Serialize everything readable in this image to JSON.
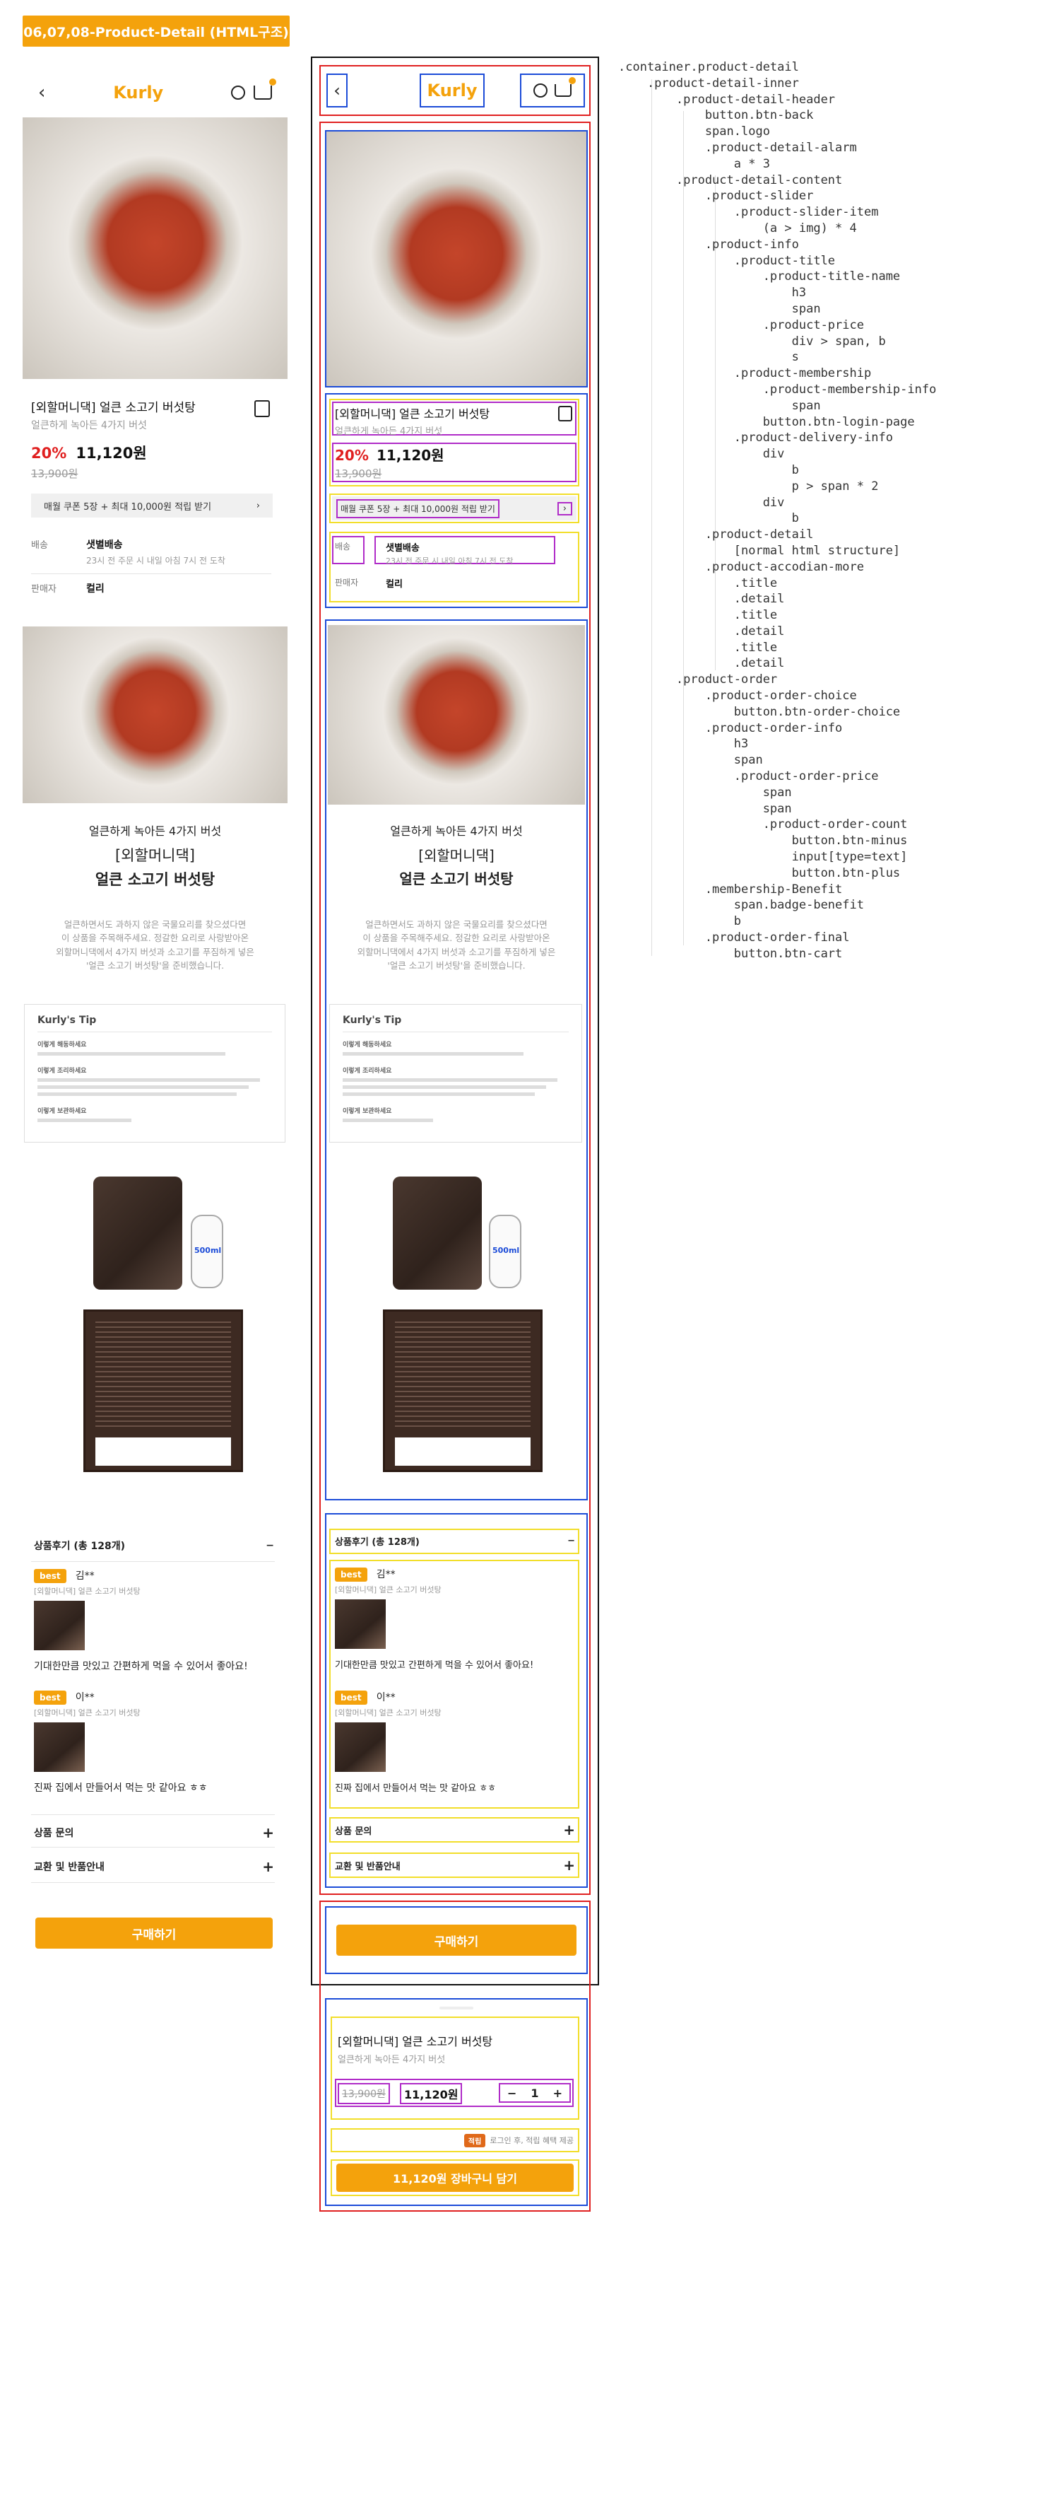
{
  "page_tag": "06,07,08-Product-Detail (HTML구조)",
  "header": {
    "logo": "Kurly",
    "back_icon": "chevron-left-icon",
    "search_icon": "search-icon",
    "cart_icon": "cart-icon"
  },
  "product": {
    "title": "[외할머니댁] 얼큰 소고기 버섯탕",
    "subtitle": "얼큰하게 녹아든 4가지 버섯",
    "discount": "20%",
    "price": "11,120원",
    "original_price": "13,900원",
    "coupon_text": "매월 쿠폰 5장 + 최대 10,000원 적립 받기"
  },
  "delivery": {
    "label1": "배송",
    "value1": "샛별배송",
    "note1": "23시 전 주문 시 내일 아침 7시 전 도착",
    "label2": "판매자",
    "value2": "컬리"
  },
  "detail": {
    "intro_line1": "얼큰하게 녹아든 4가지 버섯",
    "intro_line2": "[외할머니댁]",
    "intro_line3": "얼큰 소고기 버섯탕",
    "desc1": "얼큰하면서도 과하지 않은 국물요리를 찾으셨다면",
    "desc2": "이 상품을 주목해주세요. 정갈한 요리로 사랑받아온",
    "desc3": "외할머니댁에서 4가지 버섯과 소고기를 푸짐하게 넣은",
    "desc4": "'얼큰 소고기 버섯탕'을 준비했습니다.",
    "tip_title": "Kurly's Tip",
    "tip_h1": "이렇게 해동하세요",
    "tip_h2": "이렇게 조리하세요",
    "tip_h3": "이렇게 보관하세요",
    "can_label": "500ml"
  },
  "reviews": {
    "header": "상품후기 (총 128개)",
    "items": [
      {
        "badge": "best",
        "name": "김**",
        "product": "[외할머니댁] 얼큰 소고기 버섯탕",
        "text": "기대한만큼 맛있고 간편하게 먹을 수 있어서 좋아요!"
      },
      {
        "badge": "best",
        "name": "이**",
        "product": "[외할머니댁] 얼큰 소고기 버섯탕",
        "text": "진짜 집에서 만들어서 먹는 맛 같아요 ㅎㅎ"
      }
    ],
    "inquiry": "상품 문의",
    "exchange": "교환 및 반품안내"
  },
  "buy_label": "구매하기",
  "order_sheet": {
    "title": "[외할머니댁] 얼큰 소고기 버섯탕",
    "subtitle": "얼큰하게 녹아든 4가지 버섯",
    "original_price": "13,900원",
    "price": "11,120원",
    "quantity": "1",
    "minus": "−",
    "plus": "+",
    "benefit_badge": "적립",
    "benefit_text": "로그인 후, 적립 혜택 제공",
    "cart_button": "11,120원 장바구니 담기"
  },
  "code_tree": ".container.product-detail\n    .product-detail-inner\n        .product-detail-header\n            button.btn-back\n            span.logo\n            .product-detail-alarm\n                a * 3\n        .product-detail-content\n            .product-slider\n                .product-slider-item\n                    (a > img) * 4\n            .product-info\n                .product-title\n                    .product-title-name\n                        h3\n                        span\n                    .product-price\n                        div > span, b\n                        s\n                .product-membership\n                    .product-membership-info\n                        span\n                    button.btn-login-page\n                .product-delivery-info\n                    div\n                        b\n                        p > span * 2\n                    div\n                        b\n            .product-detail\n                [normal html structure]\n            .product-accodian-more\n                .title\n                .detail\n                .title\n                .detail\n                .title\n                .detail\n        .product-order\n            .product-order-choice\n                button.btn-order-choice\n            .product-order-info\n                h3\n                span\n                .product-order-price\n                    span\n                    span\n                    .product-order-count\n                        button.btn-minus\n                        input[type=text]\n                        button.btn-plus\n            .membership-Benefit\n                span.badge-benefit\n                b\n            .product-order-final\n                button.btn-cart"
}
